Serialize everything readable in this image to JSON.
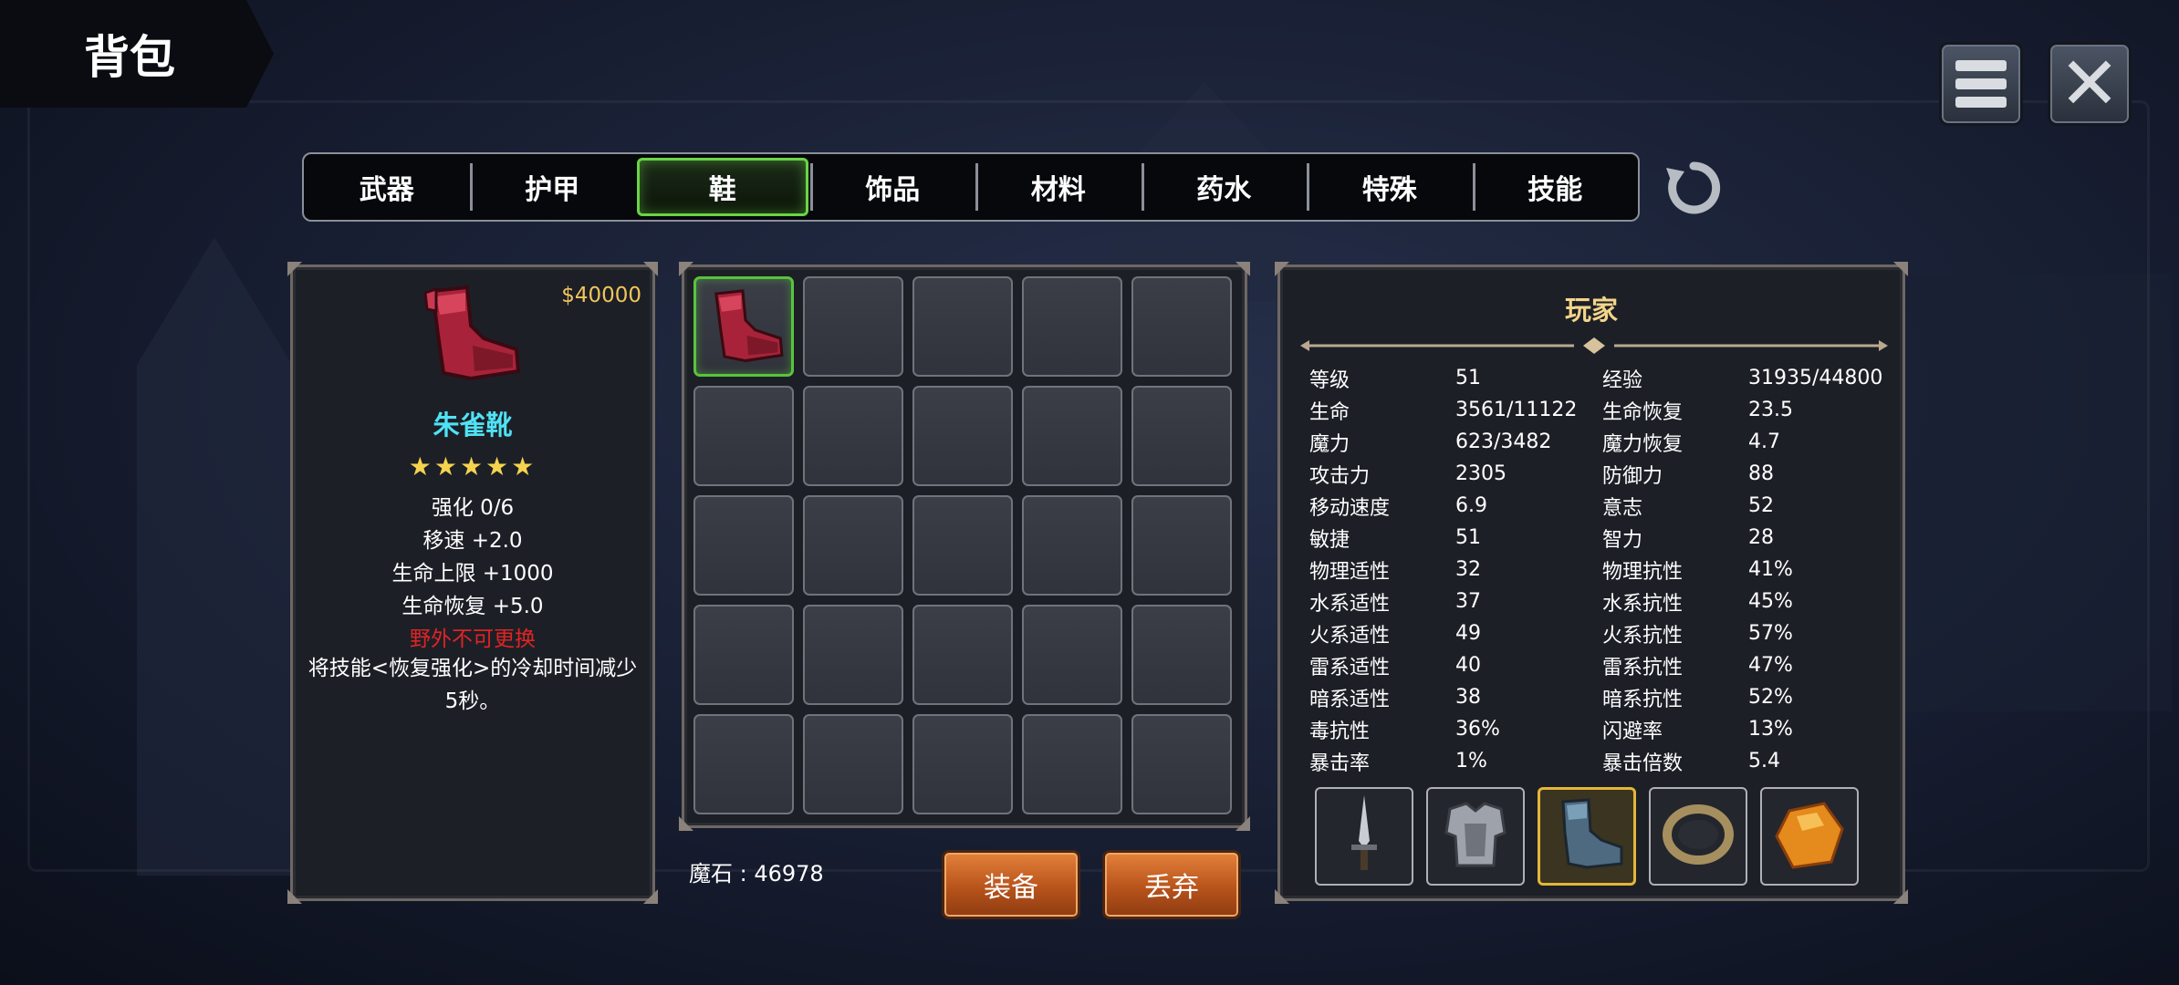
{
  "header": {
    "title": "背包"
  },
  "tabs": [
    {
      "label": "武器",
      "active": false
    },
    {
      "label": "护甲",
      "active": false
    },
    {
      "label": "鞋",
      "active": true
    },
    {
      "label": "饰品",
      "active": false
    },
    {
      "label": "材料",
      "active": false
    },
    {
      "label": "药水",
      "active": false
    },
    {
      "label": "特殊",
      "active": false
    },
    {
      "label": "技能",
      "active": false
    }
  ],
  "item_detail": {
    "price": "$40000",
    "name": "朱雀靴",
    "stars": "★★★★★",
    "star_count": 5,
    "lines": [
      "强化 0/6",
      "移速 +2.0",
      "生命上限 +1000",
      "生命恢复 +5.0"
    ],
    "warning": "野外不可更换",
    "description": "将技能<恢复强化>的冷却时间减少5秒。"
  },
  "inventory": {
    "rows": 5,
    "cols": 5,
    "filled_slots": [
      0
    ],
    "selected_slot": 0
  },
  "magic_stone": "魔石 : 46978",
  "actions": {
    "equip": "装备",
    "discard": "丢弃"
  },
  "player": {
    "title": "玩家",
    "stats": [
      [
        "等级",
        "51",
        "经验",
        "31935/44800"
      ],
      [
        "生命",
        "3561/11122",
        "生命恢复",
        "23.5"
      ],
      [
        "魔力",
        "623/3482",
        "魔力恢复",
        "4.7"
      ],
      [
        "攻击力",
        "2305",
        "防御力",
        "88"
      ],
      [
        "移动速度",
        "6.9",
        "意志",
        "52"
      ],
      [
        "敏捷",
        "51",
        "智力",
        "28"
      ],
      [
        "物理适性",
        "32",
        "物理抗性",
        "41%"
      ],
      [
        "水系适性",
        "37",
        "水系抗性",
        "45%"
      ],
      [
        "火系适性",
        "49",
        "火系抗性",
        "57%"
      ],
      [
        "雷系适性",
        "40",
        "雷系抗性",
        "47%"
      ],
      [
        "暗系适性",
        "38",
        "暗系抗性",
        "52%"
      ],
      [
        "毒抗性",
        "36%",
        "闪避率",
        "13%"
      ],
      [
        "暴击率",
        "1%",
        "暴击倍数",
        "5.4"
      ]
    ],
    "equipment": [
      {
        "icon": "dagger-icon",
        "active": false
      },
      {
        "icon": "armor-icon",
        "active": false
      },
      {
        "icon": "boots-icon",
        "active": true
      },
      {
        "icon": "ring-icon",
        "active": false
      },
      {
        "icon": "amber-stone-icon",
        "active": false
      }
    ]
  },
  "colors": {
    "accent_green": "#6ad447",
    "item_name": "#4fe3f4",
    "price": "#f1c65b",
    "warning": "#e02424",
    "button_orange": "#c9621f"
  }
}
